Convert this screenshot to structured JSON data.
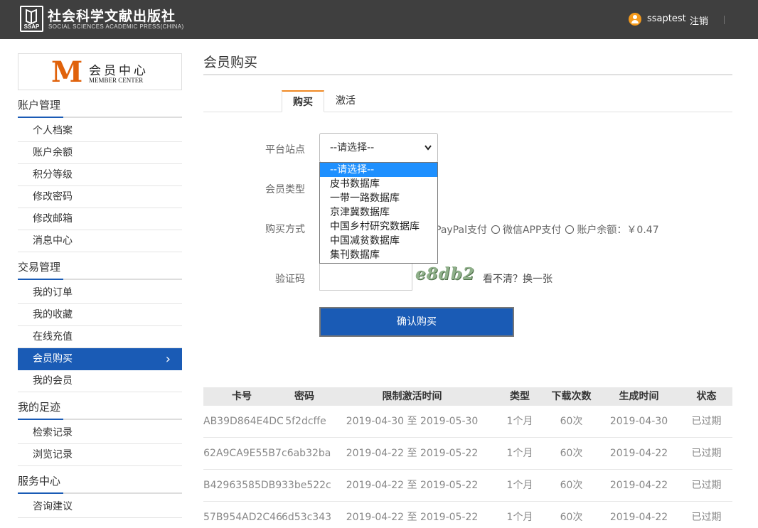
{
  "header": {
    "logo_abbr": "SSAP",
    "logo_cn": "社会科学文献出版社",
    "logo_en": "SOCIAL SCIENCES ACADEMIC PRESS(CHINA)",
    "username": "ssaptest",
    "logout_label": "注销"
  },
  "member_center": {
    "letter": "M",
    "title_cn": "会员中心",
    "title_en": "MEMBER CENTER"
  },
  "sidebar": {
    "sections": [
      {
        "title": "账户管理",
        "items": [
          "个人档案",
          "账户余额",
          "积分等级",
          "修改密码",
          "修改邮箱",
          "消息中心"
        ]
      },
      {
        "title": "交易管理",
        "items": [
          "我的订单",
          "我的收藏",
          "在线充值",
          "会员购买",
          "我的会员"
        ]
      },
      {
        "title": "我的足迹",
        "items": [
          "检索记录",
          "浏览记录"
        ]
      },
      {
        "title": "服务中心",
        "items": [
          "咨询建议"
        ]
      }
    ],
    "active_item": "会员购买",
    "active_chevron": "›"
  },
  "main": {
    "page_title": "会员购买",
    "tabs": [
      {
        "label": "购买",
        "active": true
      },
      {
        "label": "激活",
        "active": false
      }
    ],
    "form": {
      "platform_label": "平台站点",
      "platform_value": "--请选择--",
      "platform_options": [
        "--请选择--",
        "皮书数据库",
        "一带一路数据库",
        "京津冀数据库",
        "中国乡村研究数据库",
        "中国减贫数据库",
        "集刊数据库"
      ],
      "member_type_label": "会员类型",
      "payment_label": "购买方式",
      "payment_paypal": "PayPal支付",
      "payment_wechat": "微信APP支付",
      "payment_balance": "账户余额：￥0.47",
      "captcha_label": "验证码",
      "captcha_value": "",
      "captcha_image_text": "e8db2",
      "refresh_label": "看不清？换一张",
      "confirm_label": "确认购买"
    },
    "table": {
      "columns": [
        "卡号",
        "密码",
        "限制激活时间",
        "类型",
        "下载次数",
        "生成时间",
        "状态"
      ],
      "rows": [
        [
          "AB39D864E4DC",
          "5f2dcffe",
          "2019-04-30 至 2019-05-30",
          "1个月",
          "60次",
          "2019-04-30",
          "已过期"
        ],
        [
          "62A9CA9E55B7",
          "c6ab32ba",
          "2019-04-22 至 2019-05-22",
          "1个月",
          "60次",
          "2019-04-22",
          "已过期"
        ],
        [
          "B42963585DB9",
          "33be522c",
          "2019-04-22 至 2019-05-22",
          "1个月",
          "60次",
          "2019-04-22",
          "已过期"
        ],
        [
          "57B954AD2C46",
          "6d53c343",
          "2019-04-22 至 2019-05-22",
          "1个月",
          "60次",
          "2019-04-22",
          "已过期"
        ]
      ]
    }
  },
  "colors": {
    "topbar": "#3f3f3f",
    "primary": "#1a5bb5",
    "accent_orange": "#e0620b",
    "tab_accent": "#f08a24",
    "dropdown_highlight": "#1e90ff"
  }
}
